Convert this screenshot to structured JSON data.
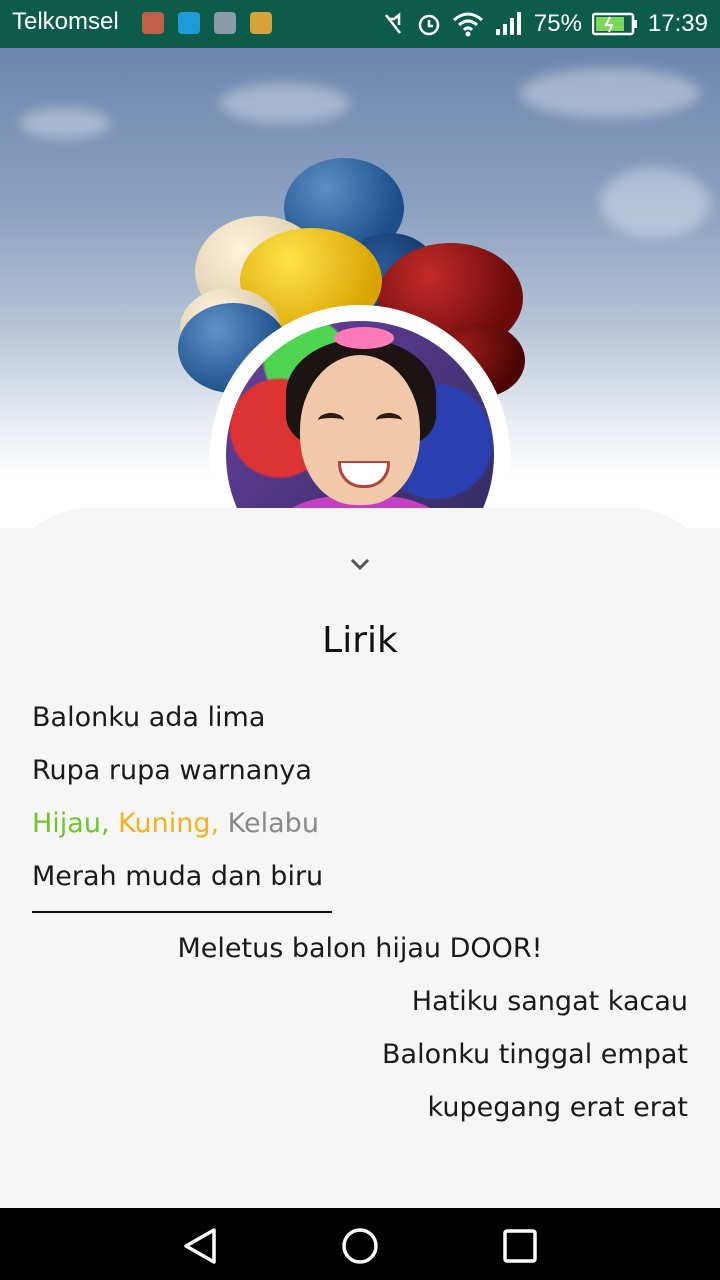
{
  "status_bar": {
    "carrier": "Telkomsel",
    "battery_percent": "75%",
    "time": "17:39"
  },
  "lyrics": {
    "title": "Lirik",
    "verse1": [
      "Balonku ada lima",
      "Rupa rupa warnanya"
    ],
    "colors_line": {
      "green_word": "Hijau,",
      "yellow_word": "Kuning,",
      "gray_word": "Kelabu",
      "green_color": "#6cc72a",
      "yellow_color": "#f3b21b",
      "gray_color": "#8a8a8a"
    },
    "verse1_end": "Merah muda dan biru",
    "chorus_center": "Meletus balon hijau DOOR!",
    "verse2_right": [
      "Hatiku sangat kacau",
      "Balonku tinggal empat",
      "kupegang erat erat"
    ]
  },
  "nav_bar": {
    "back_icon": "back-triangle-icon",
    "home_icon": "home-circle-icon",
    "recents_icon": "recents-square-icon"
  }
}
